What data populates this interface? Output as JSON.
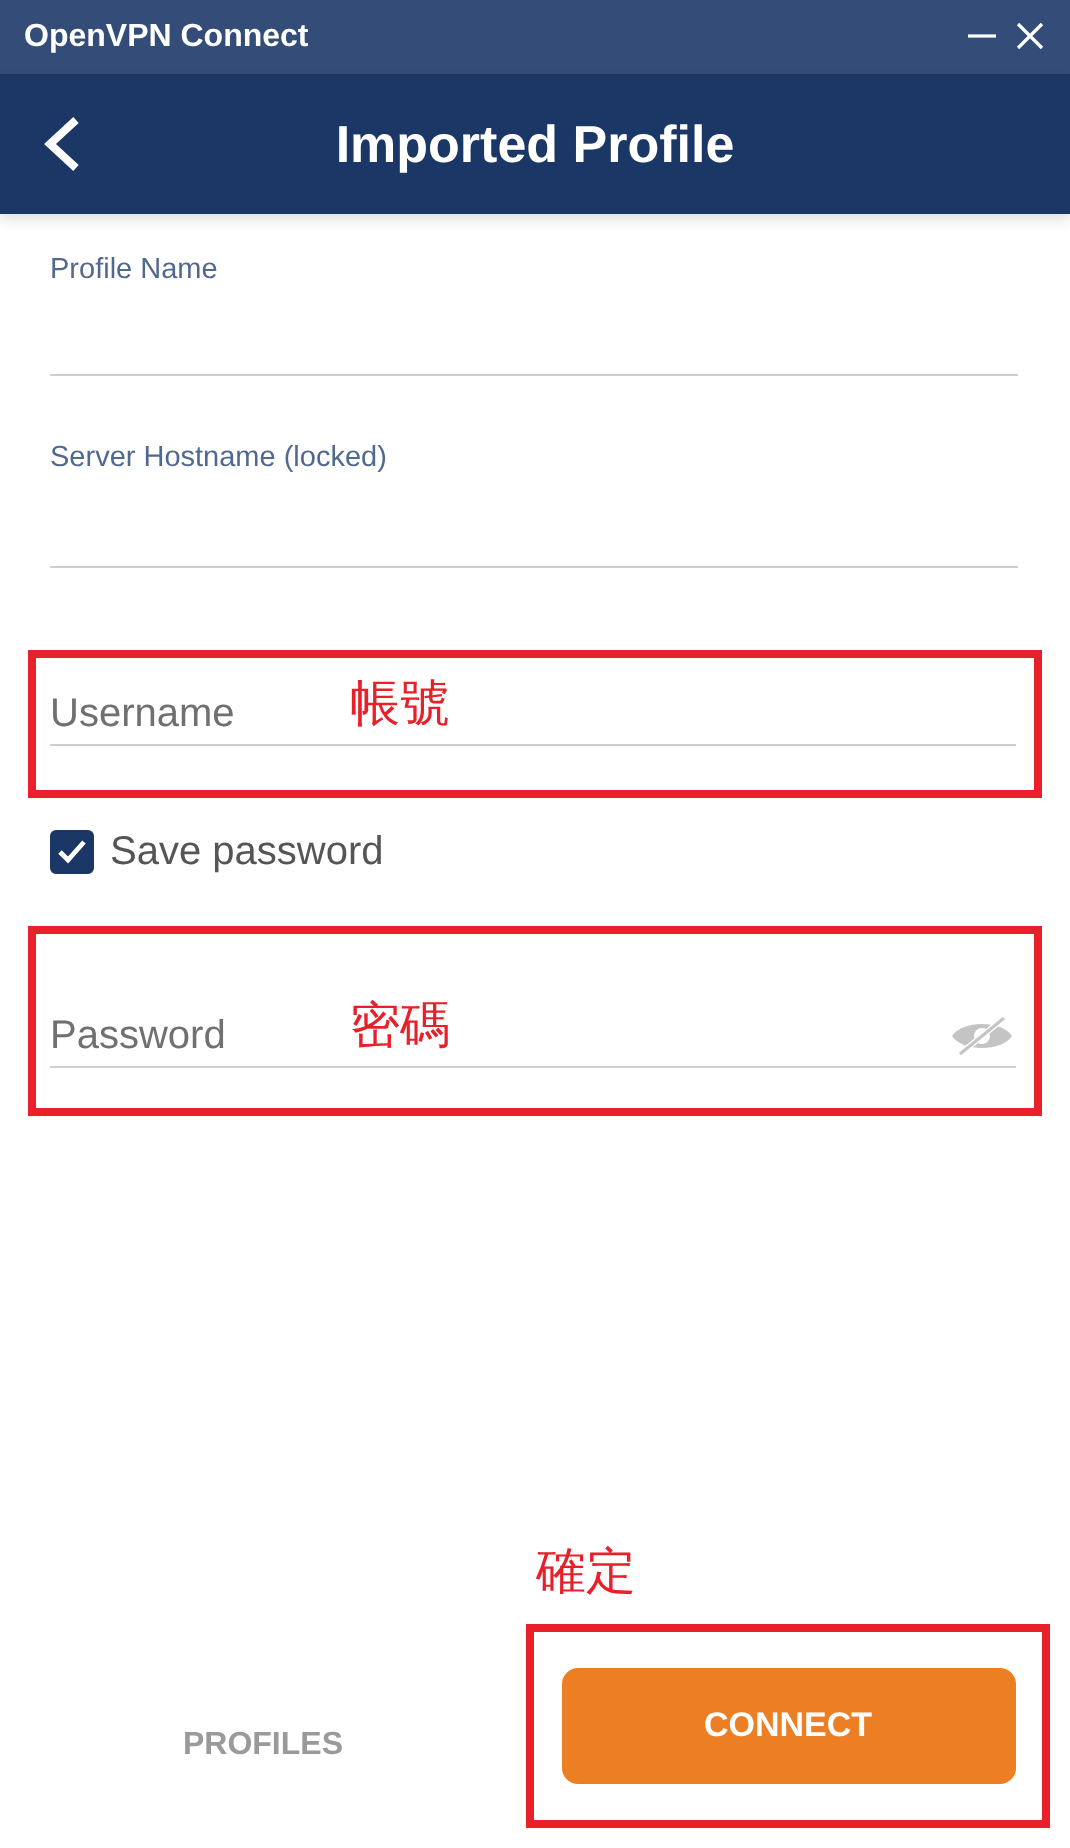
{
  "window": {
    "title": "OpenVPN Connect"
  },
  "header": {
    "title": "Imported Profile"
  },
  "profile_name": {
    "label": "Profile Name"
  },
  "server_hostname": {
    "label": "Server Hostname (locked)"
  },
  "username": {
    "placeholder": "Username",
    "annotation": "帳號"
  },
  "save_password": {
    "label": "Save password",
    "checked": true
  },
  "password": {
    "placeholder": "Password",
    "annotation": "密碼"
  },
  "footer": {
    "profiles": "PROFILES",
    "connect": "CONNECT",
    "connect_annotation": "確定"
  }
}
